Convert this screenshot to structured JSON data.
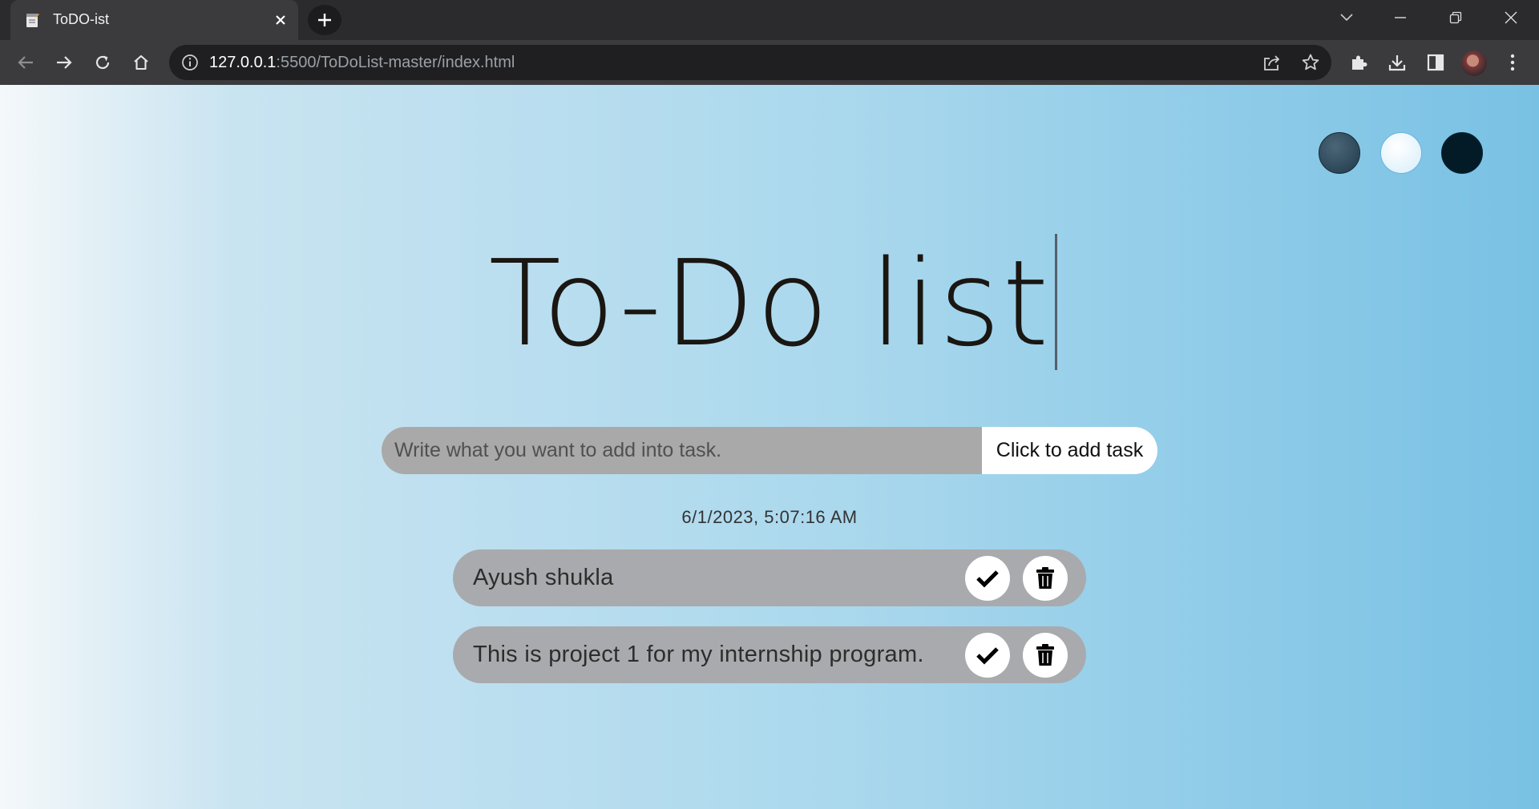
{
  "browser": {
    "tab_title": "ToDO-ist",
    "url_host": "127.0.0.1",
    "url_rest": ":5500/ToDoList-master/index.html"
  },
  "themes": [
    {
      "name": "standard",
      "color": "#2e4a5c"
    },
    {
      "name": "light",
      "color": "#e8f6fe"
    },
    {
      "name": "darker",
      "color": "#021b26"
    }
  ],
  "page": {
    "title": "To-Do list",
    "input_placeholder": "Write what you want to add into task.",
    "add_button_label": "Click to add task",
    "timestamp": "6/1/2023, 5:07:16 AM"
  },
  "tasks": [
    {
      "text": "Ayush shukla"
    },
    {
      "text": "This is project 1 for my internship program."
    }
  ]
}
